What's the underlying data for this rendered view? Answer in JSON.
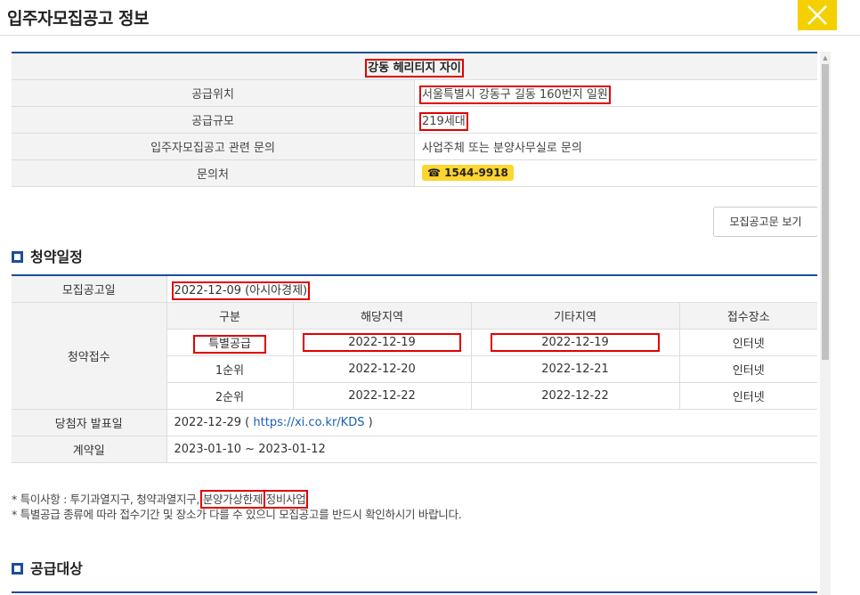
{
  "header": {
    "title": "입주자모집공고 정보"
  },
  "complex": {
    "name": "강동 헤리티지 자이",
    "rows": [
      {
        "label": "공급위치",
        "value": "서울특별시 강동구 길동 160번지 일원"
      },
      {
        "label": "공급규모",
        "value": "219세대"
      },
      {
        "label": "입주자모집공고 관련 문의",
        "value": "사업주체 또는 분양사무실로 문의"
      },
      {
        "label": "문의처",
        "value": "☎ 1544-9918"
      }
    ],
    "view_button": "모집공고문 보기"
  },
  "schedule": {
    "section_title": "청약일정",
    "announce_label": "모집공고일",
    "announce_value": "2022-12-09 (아시아경제)",
    "receipt_label": "청약접수",
    "columns": [
      "구분",
      "해당지역",
      "기타지역",
      "접수장소"
    ],
    "rows": [
      [
        "특별공급",
        "2022-12-19",
        "2022-12-19",
        "인터넷"
      ],
      [
        "1순위",
        "2022-12-20",
        "2022-12-21",
        "인터넷"
      ],
      [
        "2순위",
        "2022-12-22",
        "2022-12-22",
        "인터넷"
      ]
    ],
    "winner_label": "당첨자 발표일",
    "winner_date": "2022-12-29 ( ",
    "winner_link": "https://xi.co.kr/KDS",
    "winner_tail": " )",
    "contract_label": "계약일",
    "contract_value": "2023-01-10 ~ 2023-01-12"
  },
  "notes": {
    "line1_prefix": "* 특이사항 : 투기과열지구, 청약과열지구, ",
    "line1_tag1": "분양가상한제",
    "line1_sep": " ",
    "line1_tag2": "정비사업",
    "line2": "* 특별공급 종류에 따라 접수기간 및 장소가 다를 수 있으니 모집공고를 반드시 확인하시기 바랍니다."
  },
  "supply": {
    "section_title": "공급대상"
  },
  "colors": {
    "accent": "#1d4e9a",
    "highlight": "#e00000",
    "close": "#f5d000",
    "badge": "#ffd530"
  },
  "icons": {
    "close": "close-icon",
    "section": "square-bullet-icon",
    "phone": "phone-icon"
  }
}
